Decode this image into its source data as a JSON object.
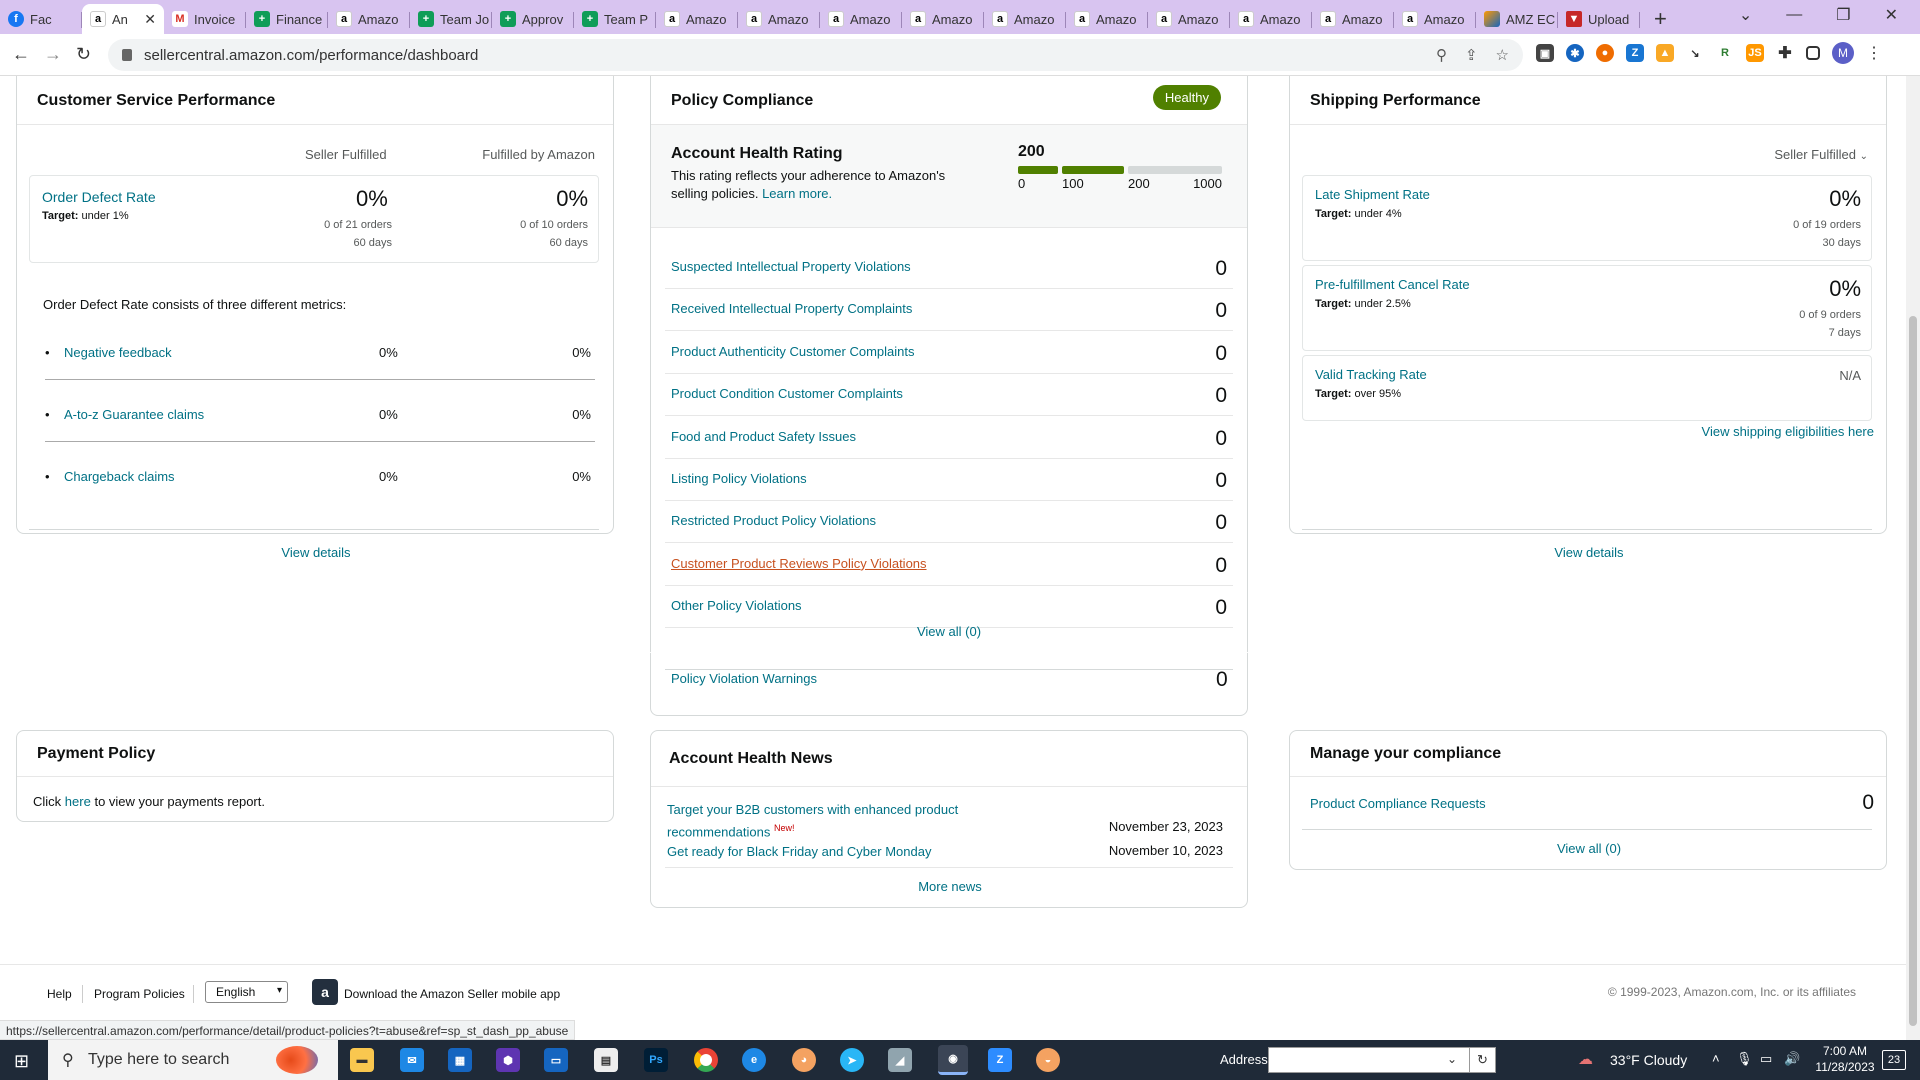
{
  "browser": {
    "tabs": [
      {
        "label": "Fac",
        "icon": "facebook-icon",
        "cls": "fb",
        "glyph": "f"
      },
      {
        "label": "An",
        "icon": "amazon-icon",
        "cls": "amz",
        "glyph": "a",
        "active": true
      },
      {
        "label": "Invoice",
        "icon": "gmail-icon",
        "cls": "gm",
        "glyph": "M"
      },
      {
        "label": "Finance",
        "icon": "sheets-icon",
        "cls": "sh",
        "glyph": "+"
      },
      {
        "label": "Amazo",
        "icon": "amazon-icon",
        "cls": "amz",
        "glyph": "a"
      },
      {
        "label": "Team Jo",
        "icon": "sheets-icon",
        "cls": "sh",
        "glyph": "+"
      },
      {
        "label": "Approv",
        "icon": "sheets-icon",
        "cls": "sh",
        "glyph": "+"
      },
      {
        "label": "Team P",
        "icon": "sheets-icon",
        "cls": "sh",
        "glyph": "+"
      },
      {
        "label": "Amazo",
        "icon": "amazon-icon",
        "cls": "amz",
        "glyph": "a"
      },
      {
        "label": "Amazo",
        "icon": "amazon-icon",
        "cls": "amz",
        "glyph": "a"
      },
      {
        "label": "Amazo",
        "icon": "amazon-icon",
        "cls": "amz",
        "glyph": "a"
      },
      {
        "label": "Amazo",
        "icon": "amazon-icon",
        "cls": "amz",
        "glyph": "a"
      },
      {
        "label": "Amazo",
        "icon": "amazon-icon",
        "cls": "amz",
        "glyph": "a"
      },
      {
        "label": "Amazo",
        "icon": "amazon-icon",
        "cls": "amz",
        "glyph": "a"
      },
      {
        "label": "Amazo",
        "icon": "amazon-icon",
        "cls": "amz",
        "glyph": "a"
      },
      {
        "label": "Amazo",
        "icon": "amazon-icon",
        "cls": "amz",
        "glyph": "a"
      },
      {
        "label": "Amazo",
        "icon": "amazon-icon",
        "cls": "amz",
        "glyph": "a"
      },
      {
        "label": "Amazo",
        "icon": "amazon-icon",
        "cls": "amz",
        "glyph": "a"
      },
      {
        "label": "AMZ EC",
        "icon": "amz-ec-icon",
        "cls": "amzec",
        "glyph": ""
      },
      {
        "label": "Upload",
        "icon": "upload-icon",
        "cls": "up",
        "glyph": "▼"
      }
    ],
    "url": "sellercentral.amazon.com/performance/dashboard",
    "status_url": "https://sellercentral.amazon.com/performance/detail/product-policies?t=abuse&ref=sp_st_dash_pp_abuse"
  },
  "csp": {
    "title": "Customer Service Performance",
    "col_sf": "Seller Fulfilled",
    "col_fba": "Fulfilled by Amazon",
    "odr_label": "Order Defect Rate",
    "odr_target_label": "Target:",
    "odr_target": "under 1%",
    "sf_value": "0%",
    "sf_orders": "0 of 21 orders",
    "sf_days": "60 days",
    "fba_value": "0%",
    "fba_orders": "0 of 10 orders",
    "fba_days": "60 days",
    "consists": "Order Defect Rate consists of three different metrics:",
    "metrics": [
      {
        "label": "Negative feedback",
        "sf": "0%",
        "fba": "0%"
      },
      {
        "label": "A-to-z Guarantee claims",
        "sf": "0%",
        "fba": "0%"
      },
      {
        "label": "Chargeback claims",
        "sf": "0%",
        "fba": "0%"
      }
    ],
    "view_details": "View details"
  },
  "policy": {
    "title": "Policy Compliance",
    "badge": "Healthy",
    "ahr_title": "Account Health Rating",
    "ahr_desc": "This rating reflects your adherence to Amazon's selling policies.",
    "learn_more": "Learn more.",
    "ahr_value": "200",
    "ahr_score": 200,
    "scale": [
      "0",
      "100",
      "200",
      "1000"
    ],
    "rows": [
      {
        "label": "Suspected Intellectual Property Violations",
        "count": "0"
      },
      {
        "label": "Received Intellectual Property Complaints",
        "count": "0"
      },
      {
        "label": "Product Authenticity Customer Complaints",
        "count": "0"
      },
      {
        "label": "Product Condition Customer Complaints",
        "count": "0"
      },
      {
        "label": "Food and Product Safety Issues",
        "count": "0"
      },
      {
        "label": "Listing Policy Violations",
        "count": "0"
      },
      {
        "label": "Restricted Product Policy Violations",
        "count": "0"
      },
      {
        "label": "Customer Product Reviews Policy Violations",
        "count": "0"
      },
      {
        "label": "Other Policy Violations",
        "count": "0"
      }
    ],
    "view_all": "View all (0)",
    "warnings_label": "Policy Violation Warnings",
    "warnings_count": "0"
  },
  "shipping": {
    "title": "Shipping Performance",
    "filter": "Seller Fulfilled",
    "metrics": [
      {
        "label": "Late Shipment Rate",
        "target": "under 4%",
        "value": "0%",
        "orders": "0 of 19 orders",
        "days": "30 days"
      },
      {
        "label": "Pre-fulfillment Cancel Rate",
        "target": "under 2.5%",
        "value": "0%",
        "orders": "0 of 9 orders",
        "days": "7 days"
      },
      {
        "label": "Valid Tracking Rate",
        "target": "over 95%",
        "value": "N/A",
        "orders": "",
        "days": ""
      }
    ],
    "target_label": "Target:",
    "eligibilities": "View shipping eligibilities here",
    "view_details": "View details"
  },
  "payment": {
    "title": "Payment Policy",
    "text_pre": "Click",
    "link": "here",
    "text_post": "to view your payments report."
  },
  "news": {
    "title": "Account Health News",
    "items": [
      {
        "title": "Target your B2B customers with enhanced product recommendations",
        "badge": "New!",
        "date": "November 23, 2023"
      },
      {
        "title": "Get ready for Black Friday and Cyber Monday",
        "badge": "",
        "date": "November 10, 2023"
      }
    ],
    "more": "More news"
  },
  "compliance": {
    "title": "Manage your compliance",
    "row_label": "Product Compliance Requests",
    "row_count": "0",
    "view_all": "View all (0)"
  },
  "footer": {
    "help": "Help",
    "policies": "Program Policies",
    "language": "English",
    "app": "Download the Amazon Seller mobile app",
    "copyright": "© 1999-2023, Amazon.com, Inc. or its affiliates"
  },
  "taskbar": {
    "search_placeholder": "Type here to search",
    "address_label": "Address",
    "weather": "33°F  Cloudy",
    "time": "7:00 AM",
    "date": "11/28/2023",
    "notifications": "23"
  },
  "colors": {
    "accent": "#007185",
    "healthy": "#508000",
    "bar_fill": "#508000",
    "bar_empty": "#d5d9d9",
    "visited_link": "#c7511f"
  }
}
